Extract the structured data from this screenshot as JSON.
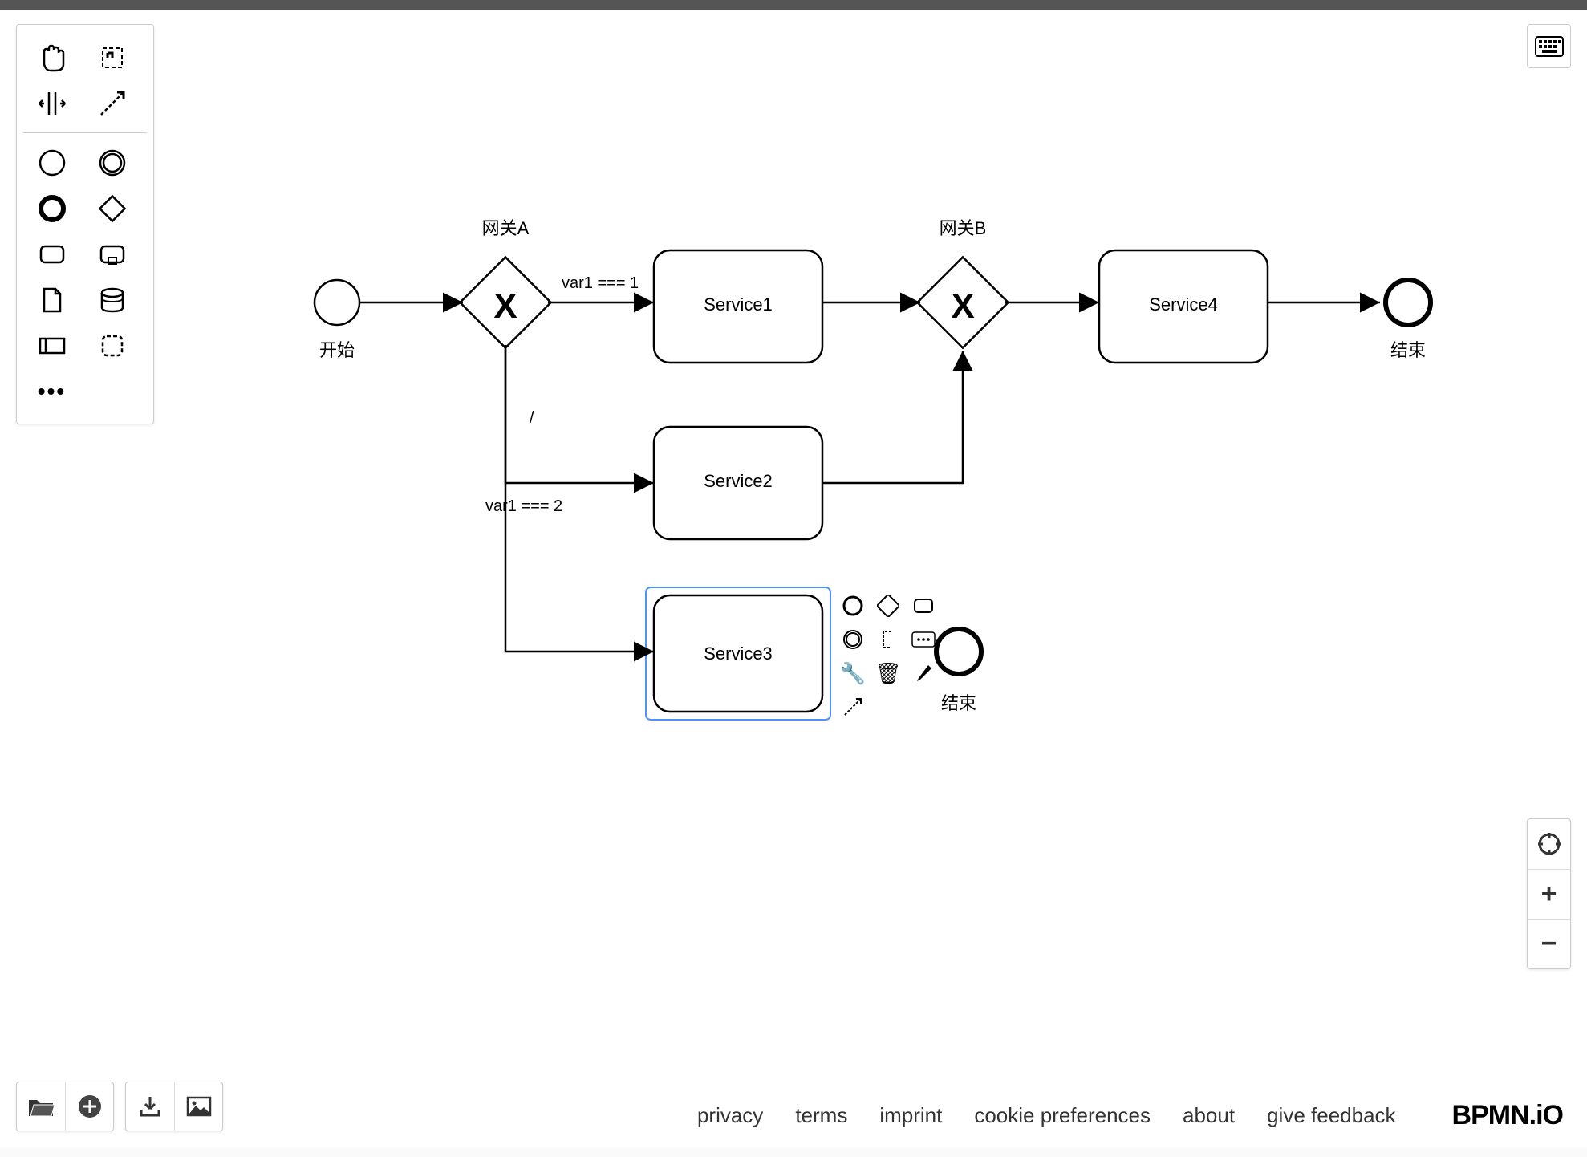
{
  "diagram": {
    "start": {
      "label": "开始"
    },
    "gatewayA": {
      "label": "网关A"
    },
    "gatewayB": {
      "label": "网关B"
    },
    "task1": {
      "label": "Service1"
    },
    "task2": {
      "label": "Service2"
    },
    "task3": {
      "label": "Service3"
    },
    "task4": {
      "label": "Service4"
    },
    "end1": {
      "label": "结束"
    },
    "end2": {
      "label": "结束"
    },
    "flows": {
      "cond1": "var1 === 1",
      "cond2": "/",
      "cond3": "var1 === 2"
    }
  },
  "footer": {
    "privacy": "privacy",
    "terms": "terms",
    "imprint": "imprint",
    "cookie": "cookie preferences",
    "about": "about",
    "feedback": "give feedback",
    "brand": "BPMN.iO"
  }
}
